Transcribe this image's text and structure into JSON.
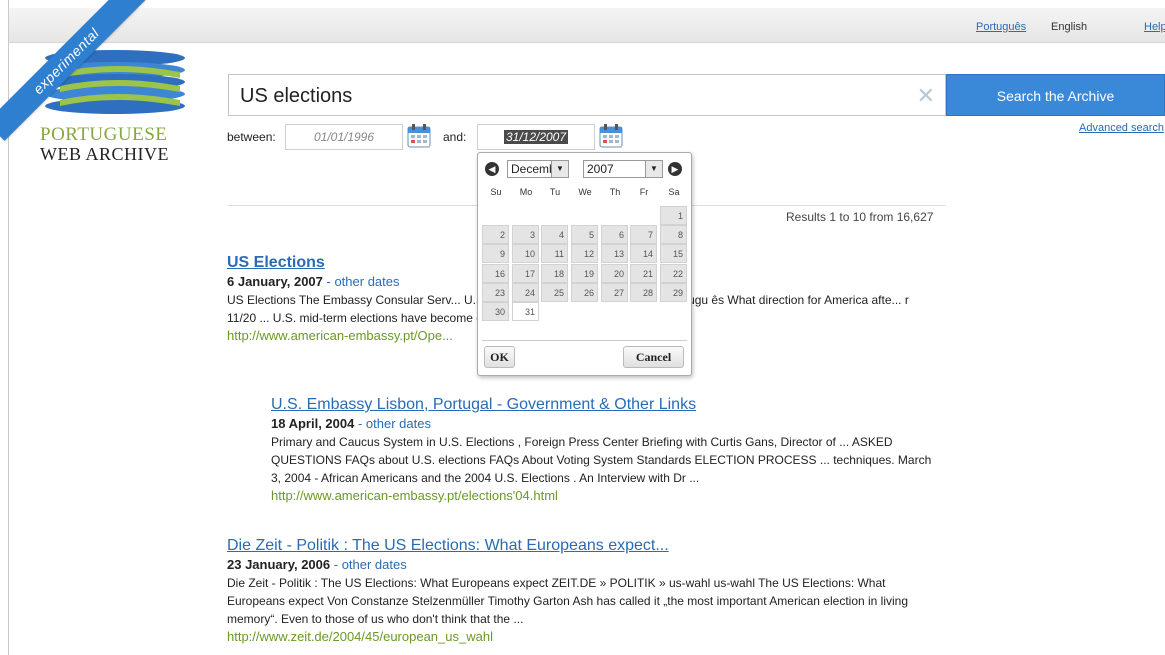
{
  "header": {
    "lang_pt": "Português",
    "lang_en": "English",
    "help": "Help"
  },
  "logo": {
    "ribbon": "experimental",
    "line1": "PORTUGUESE",
    "line2": "WEB ARCHIVE"
  },
  "search": {
    "query": "US elections",
    "button": "Search the Archive",
    "advanced": "Advanced search",
    "between_label": "between:",
    "and_label": "and:",
    "date_from": "01/01/1996",
    "date_to": "31/12/2007"
  },
  "calendar": {
    "month": "Decemb",
    "year": "2007",
    "weekdays": [
      "Su",
      "Mo",
      "Tu",
      "We",
      "Th",
      "Fr",
      "Sa"
    ],
    "first_weekday": 6,
    "days_in_month": 31,
    "selected_day": 31,
    "ok": "OK",
    "cancel": "Cancel"
  },
  "results": {
    "count": "Results 1 to 10 from 16,627",
    "items": [
      {
        "title": "US Elections",
        "date": "6 January, 2007",
        "other_dates": "other dates",
        "snippet": "US Elections The Embassy Consular Serv... U.S. Foreign Policy U.S. Government Portugu ês What direction for America afte... r 11/20 ... U.S. mid-term elections have become clear, many people are speculatin...",
        "url": "http://www.american-embassy.pt/Ope..."
      },
      {
        "title": "U.S. Embassy Lisbon, Portugal - Government & Other Links",
        "date": "18 April, 2004",
        "other_dates": "other dates",
        "snippet": "Primary and Caucus System in U.S. Elections , Foreign Press Center Briefing with Curtis Gans, Director of ... ASKED QUESTIONS FAQs about U.S. elections  FAQs About Voting System Standards   ELECTION PROCESS ... techniques.   March 3, 2004 - African Americans and the 2004 U.S. Elections . An Interview with Dr ...",
        "url": "http://www.american-embassy.pt/elections'04.html"
      },
      {
        "title": "Die Zeit - Politik : The US Elections: What Europeans expect...",
        "date": "23 January, 2006",
        "other_dates": "other dates",
        "snippet": "Die Zeit - Politik : The US Elections: What Europeans expect ZEIT.DE » POLITIK » us-wahl us-wahl The US Elections: What Europeans expect Von Constanze Stelzenmüller Timothy Garton Ash has called it „the most important American election in living memory“. Even to those of us who don't think that the ...",
        "url": "http://www.zeit.de/2004/45/european_us_wahl"
      }
    ]
  }
}
